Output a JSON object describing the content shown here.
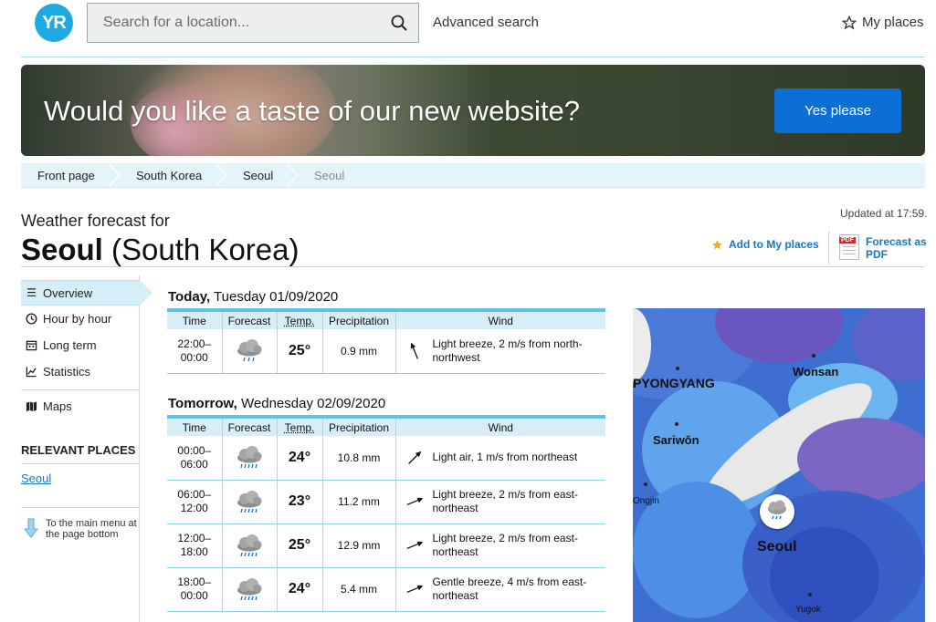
{
  "header": {
    "logo_text": "YR",
    "search_placeholder": "Search for a location...",
    "advanced_search": "Advanced search",
    "my_places": "My places"
  },
  "banner": {
    "text": "Would you like a taste of our new website?",
    "button": "Yes please"
  },
  "breadcrumb": [
    "Front page",
    "South Korea",
    "Seoul",
    "Seoul"
  ],
  "title": {
    "prefix": "Weather forecast for",
    "city": "Seoul",
    "country": "(South Korea)",
    "updated": "Updated at 17:59.",
    "add_to_places": "Add to My places",
    "pdf_badge": "PDF",
    "forecast_pdf": "Forecast as PDF"
  },
  "nav": {
    "items": [
      "Overview",
      "Hour by hour",
      "Long term",
      "Statistics",
      "Maps"
    ],
    "relevant_places_heading": "RELEVANT PLACES",
    "relevant_places": [
      "Seoul"
    ],
    "main_menu": "To the main menu at the page bottom"
  },
  "columns": {
    "time": "Time",
    "forecast": "Forecast",
    "temp": "Temp.",
    "precipitation": "Precipitation",
    "wind": "Wind"
  },
  "today": {
    "label": "Today,",
    "date": "Tuesday 01/09/2020",
    "rows": [
      {
        "from": "22:00–",
        "to": "00:00",
        "temp": "25°",
        "precip": "0.9 mm",
        "wind": "Light breeze, 2 m/s from north-northwest",
        "wind_from_deg": 337.5,
        "icon": "light-rain-cloud-icon"
      }
    ]
  },
  "tomorrow": {
    "label": "Tomorrow,",
    "date": "Wednesday 02/09/2020",
    "rows": [
      {
        "from": "00:00–",
        "to": "06:00",
        "temp": "24°",
        "precip": "10.8 mm",
        "wind": "Light air, 1 m/s from northeast",
        "wind_from_deg": 45,
        "icon": "heavy-rain-cloud-icon"
      },
      {
        "from": "06:00–",
        "to": "12:00",
        "temp": "23°",
        "precip": "11.2 mm",
        "wind": "Light breeze, 2 m/s from east-northeast",
        "wind_from_deg": 67.5,
        "icon": "heavy-rain-cloud-icon"
      },
      {
        "from": "12:00–",
        "to": "18:00",
        "temp": "25°",
        "precip": "12.9 mm",
        "wind": "Light breeze, 2 m/s from east-northeast",
        "wind_from_deg": 67.5,
        "icon": "heavy-rain-cloud-icon"
      },
      {
        "from": "18:00–",
        "to": "00:00",
        "temp": "24°",
        "precip": "5.4 mm",
        "wind": "Gentle breeze, 4 m/s from east-northeast",
        "wind_from_deg": 67.5,
        "icon": "heavy-rain-cloud-icon"
      }
    ]
  },
  "map": {
    "labels": [
      "PYONGYANG",
      "Wonsan",
      "Sariwŏn",
      "Ongjin",
      "Seoul",
      "Yugok"
    ]
  },
  "colors": {
    "brand": "#1fa9e3",
    "link": "#1677c4",
    "temp_warm": "#c41e22",
    "button": "#0b6fd6",
    "table_accent": "#5ec2ea"
  }
}
